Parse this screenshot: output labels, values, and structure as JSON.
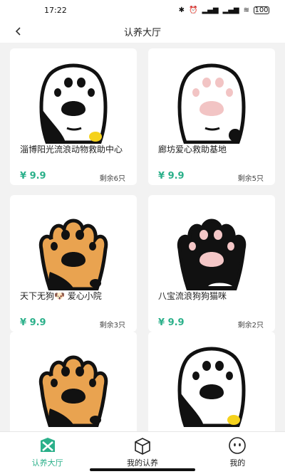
{
  "status_bar": {
    "time": "17:22",
    "battery": "100",
    "icons": [
      "bluetooth-icon",
      "alarm-icon",
      "signal-icon",
      "signal-icon",
      "wifi-icon",
      "battery-icon"
    ]
  },
  "nav": {
    "title": "认养大厅",
    "back_icon": "chevron-left-icon"
  },
  "cards": [
    {
      "name": "淄博阳光流浪动物救助中心",
      "price": "¥ 9.9",
      "remain": "剩余6只",
      "paw": "white",
      "accent": "#f5d21c"
    },
    {
      "name": "廊坊爱心救助基地",
      "price": "¥ 9.9",
      "remain": "剩余5只",
      "paw": "white-pink",
      "accent": "#000000"
    },
    {
      "name": "天下无狗🐶 爱心小院",
      "price": "¥ 9.9",
      "remain": "剩余3只",
      "paw": "orange",
      "accent": "#000000"
    },
    {
      "name": "八宝流浪狗狗猫咪",
      "price": "¥ 9.9",
      "remain": "剩余2只",
      "paw": "black",
      "accent": "#000000"
    },
    {
      "name": "",
      "price": "",
      "remain": "",
      "paw": "orange",
      "accent": "#000000"
    },
    {
      "name": "",
      "price": "",
      "remain": "",
      "paw": "white",
      "accent": "#f5d21c"
    }
  ],
  "tabs": [
    {
      "label": "认养大厅",
      "icon": "paw-home-icon",
      "active": true
    },
    {
      "label": "我的认养",
      "icon": "box-icon",
      "active": false
    },
    {
      "label": "我的",
      "icon": "face-icon",
      "active": false
    }
  ],
  "colors": {
    "accent": "#2bb08a",
    "background": "#f2f2f2",
    "card": "#ffffff"
  }
}
